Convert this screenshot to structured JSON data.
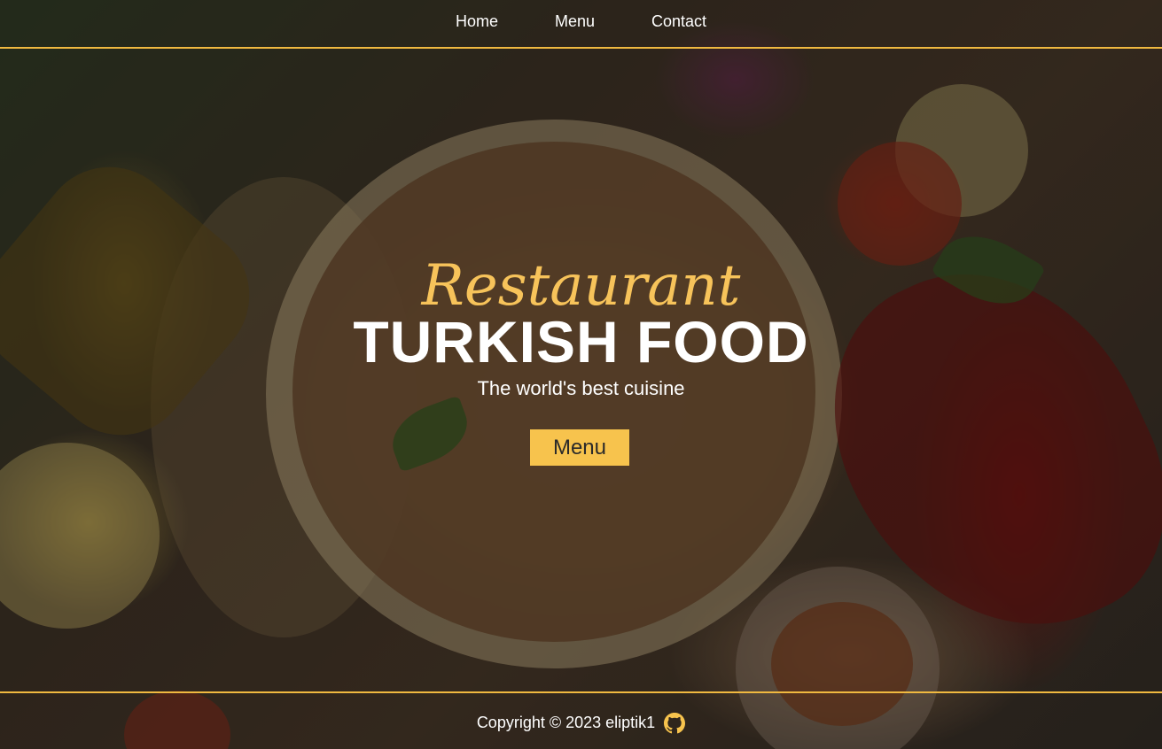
{
  "nav": {
    "items": [
      {
        "label": "Home"
      },
      {
        "label": "Menu"
      },
      {
        "label": "Contact"
      }
    ]
  },
  "hero": {
    "script_title": "Restaurant",
    "headline": "TURKISH FOOD",
    "subtitle": "The world's best cuisine",
    "cta_label": "Menu"
  },
  "footer": {
    "copyright": "Copyright © 2023 eliptik1",
    "icon": "github-icon"
  },
  "colors": {
    "accent": "#f7c34d",
    "border": "#f0b940",
    "text": "#ffffff"
  }
}
